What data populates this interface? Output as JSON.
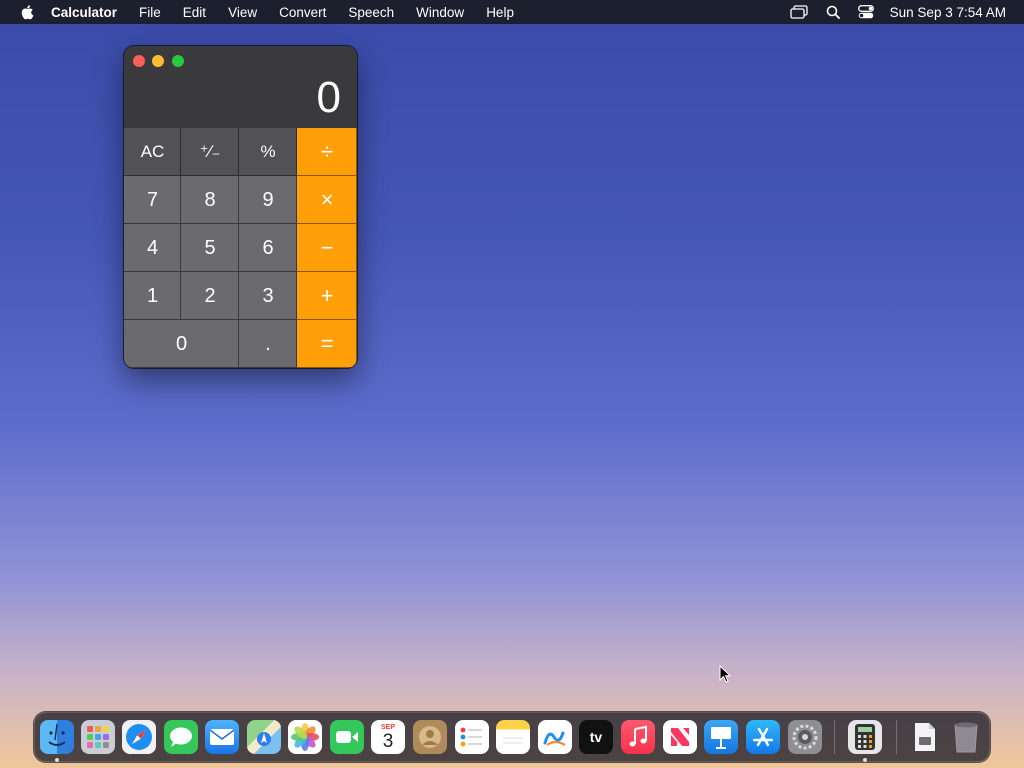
{
  "menubar": {
    "app_name": "Calculator",
    "items": [
      "File",
      "Edit",
      "View",
      "Convert",
      "Speech",
      "Window",
      "Help"
    ],
    "clock": "Sun Sep 3  7:54 AM"
  },
  "calculator": {
    "display": "0",
    "keys": {
      "ac": "AC",
      "sign": "⁺∕₋",
      "percent": "%",
      "divide": "÷",
      "seven": "7",
      "eight": "8",
      "nine": "9",
      "multiply": "×",
      "four": "4",
      "five": "5",
      "six": "6",
      "minus": "−",
      "one": "1",
      "two": "2",
      "three": "3",
      "plus": "+",
      "zero": "0",
      "decimal": ".",
      "equals": "="
    }
  },
  "dock": {
    "calendar_month": "SEP",
    "calendar_day": "3",
    "tv_label": "tv",
    "apps": [
      "finder",
      "launchpad",
      "safari",
      "messages",
      "mail",
      "maps",
      "photos",
      "facetime",
      "calendar",
      "contacts",
      "reminders",
      "notes",
      "freeform",
      "tv",
      "music",
      "news",
      "keynote",
      "app-store",
      "system-settings",
      "calculator",
      "preview",
      "trash"
    ]
  },
  "colors": {
    "operator": "#ff9f0a",
    "function_key": "#525254",
    "number_key": "#6b6b6d"
  }
}
